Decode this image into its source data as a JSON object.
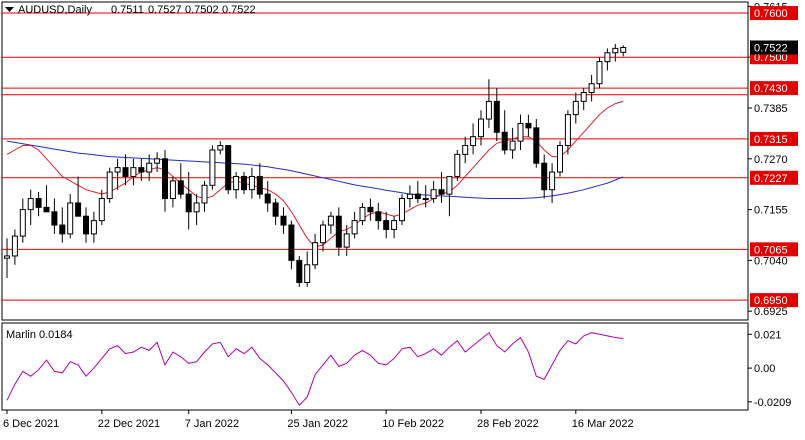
{
  "header": {
    "symbol": "AUDUSD,Daily",
    "open": "0.7511",
    "high": "0.7527",
    "low": "0.7502",
    "close": "0.7522"
  },
  "colors": {
    "background": "#ffffff",
    "frame": "#000000",
    "level_line": "#e00000",
    "level_label_bg": "#e00000",
    "level_label_text": "#ffffff",
    "ma_fast": "#e0202a",
    "ma_slow": "#2030c0",
    "indicator": "#b000b0",
    "current_label_bg": "#000000",
    "current_label_text": "#ffffff"
  },
  "chart_data": [
    {
      "type": "candlestick",
      "y_ticks": [
        "0.7615",
        "0.7500",
        "0.7385",
        "0.7270",
        "0.7155",
        "0.7040",
        "0.6925"
      ],
      "ylim": [
        0.6905,
        0.7625
      ],
      "x_ticks": [
        {
          "label": "6 Dec 2021",
          "index": 0
        },
        {
          "label": "22 Dec 2021",
          "index": 12
        },
        {
          "label": "7 Jan 2022",
          "index": 23
        },
        {
          "label": "25 Jan 2022",
          "index": 36
        },
        {
          "label": "10 Feb 2022",
          "index": 48
        },
        {
          "label": "28 Feb 2022",
          "index": 60
        },
        {
          "label": "16 Mar 2022",
          "index": 72
        }
      ],
      "levels": [
        "0.7600",
        "0.7500",
        "0.7430",
        "0.7415",
        "0.7315",
        "0.7227",
        "0.7065",
        "0.6950"
      ],
      "level_labels": [
        "0.7600",
        "0.7500",
        "0.7430",
        "0.7315",
        "0.7227",
        "0.7065",
        "0.6950"
      ],
      "current_price": "0.7522",
      "ohlc": [
        [
          0.7045,
          0.709,
          0.7,
          0.705
        ],
        [
          0.705,
          0.711,
          0.703,
          0.7095
        ],
        [
          0.7095,
          0.718,
          0.708,
          0.7155
        ],
        [
          0.7155,
          0.72,
          0.712,
          0.718
        ],
        [
          0.718,
          0.7195,
          0.714,
          0.716
        ],
        [
          0.716,
          0.721,
          0.715,
          0.715
        ],
        [
          0.715,
          0.718,
          0.71,
          0.712
        ],
        [
          0.712,
          0.716,
          0.708,
          0.71
        ],
        [
          0.71,
          0.719,
          0.709,
          0.717
        ],
        [
          0.717,
          0.723,
          0.714,
          0.714
        ],
        [
          0.714,
          0.716,
          0.708,
          0.71
        ],
        [
          0.71,
          0.715,
          0.708,
          0.713
        ],
        [
          0.713,
          0.72,
          0.712,
          0.718
        ],
        [
          0.718,
          0.725,
          0.717,
          0.724
        ],
        [
          0.724,
          0.727,
          0.72,
          0.725
        ],
        [
          0.725,
          0.728,
          0.721,
          0.723
        ],
        [
          0.723,
          0.727,
          0.721,
          0.725
        ],
        [
          0.725,
          0.727,
          0.722,
          0.724
        ],
        [
          0.724,
          0.728,
          0.722,
          0.726
        ],
        [
          0.726,
          0.7285,
          0.724,
          0.727
        ],
        [
          0.727,
          0.729,
          0.715,
          0.718
        ],
        [
          0.718,
          0.723,
          0.716,
          0.722
        ],
        [
          0.722,
          0.726,
          0.718,
          0.719
        ],
        [
          0.719,
          0.724,
          0.711,
          0.715
        ],
        [
          0.715,
          0.719,
          0.712,
          0.717
        ],
        [
          0.717,
          0.722,
          0.715,
          0.721
        ],
        [
          0.721,
          0.73,
          0.72,
          0.729
        ],
        [
          0.729,
          0.731,
          0.728,
          0.73
        ],
        [
          0.73,
          0.73,
          0.719,
          0.72
        ],
        [
          0.72,
          0.724,
          0.718,
          0.723
        ],
        [
          0.723,
          0.724,
          0.719,
          0.72
        ],
        [
          0.72,
          0.725,
          0.718,
          0.723
        ],
        [
          0.723,
          0.726,
          0.718,
          0.719
        ],
        [
          0.719,
          0.722,
          0.715,
          0.717
        ],
        [
          0.717,
          0.718,
          0.712,
          0.714
        ],
        [
          0.714,
          0.716,
          0.71,
          0.712
        ],
        [
          0.712,
          0.713,
          0.702,
          0.704
        ],
        [
          0.704,
          0.705,
          0.698,
          0.699
        ],
        [
          0.699,
          0.706,
          0.698,
          0.703
        ],
        [
          0.703,
          0.71,
          0.702,
          0.708
        ],
        [
          0.708,
          0.713,
          0.706,
          0.712
        ],
        [
          0.712,
          0.715,
          0.71,
          0.714
        ],
        [
          0.714,
          0.716,
          0.705,
          0.707
        ],
        [
          0.707,
          0.712,
          0.705,
          0.71
        ],
        [
          0.71,
          0.715,
          0.709,
          0.713
        ],
        [
          0.713,
          0.717,
          0.712,
          0.716
        ],
        [
          0.716,
          0.718,
          0.713,
          0.715
        ],
        [
          0.715,
          0.717,
          0.711,
          0.713
        ],
        [
          0.713,
          0.715,
          0.709,
          0.711
        ],
        [
          0.711,
          0.714,
          0.709,
          0.713
        ],
        [
          0.713,
          0.719,
          0.712,
          0.718
        ],
        [
          0.718,
          0.721,
          0.716,
          0.719
        ],
        [
          0.719,
          0.722,
          0.717,
          0.718
        ],
        [
          0.718,
          0.721,
          0.716,
          0.718
        ],
        [
          0.718,
          0.722,
          0.717,
          0.72
        ],
        [
          0.72,
          0.724,
          0.717,
          0.719
        ],
        [
          0.719,
          0.723,
          0.714,
          0.723
        ],
        [
          0.723,
          0.729,
          0.722,
          0.728
        ],
        [
          0.728,
          0.732,
          0.726,
          0.73
        ],
        [
          0.73,
          0.735,
          0.728,
          0.732
        ],
        [
          0.732,
          0.738,
          0.73,
          0.736
        ],
        [
          0.736,
          0.745,
          0.734,
          0.74
        ],
        [
          0.74,
          0.743,
          0.731,
          0.733
        ],
        [
          0.733,
          0.738,
          0.728,
          0.729
        ],
        [
          0.729,
          0.734,
          0.727,
          0.731
        ],
        [
          0.731,
          0.737,
          0.729,
          0.735
        ],
        [
          0.735,
          0.737,
          0.732,
          0.734
        ],
        [
          0.734,
          0.736,
          0.725,
          0.726
        ],
        [
          0.726,
          0.728,
          0.718,
          0.72
        ],
        [
          0.72,
          0.726,
          0.717,
          0.724
        ],
        [
          0.724,
          0.731,
          0.723,
          0.73
        ],
        [
          0.73,
          0.738,
          0.728,
          0.737
        ],
        [
          0.737,
          0.742,
          0.735,
          0.74
        ],
        [
          0.74,
          0.743,
          0.738,
          0.742
        ],
        [
          0.742,
          0.746,
          0.74,
          0.744
        ],
        [
          0.744,
          0.75,
          0.743,
          0.749
        ],
        [
          0.749,
          0.752,
          0.747,
          0.751
        ],
        [
          0.751,
          0.753,
          0.749,
          0.752
        ],
        [
          0.7511,
          0.7527,
          0.7502,
          0.7522
        ]
      ],
      "ma_fast": [
        0.728,
        0.729,
        0.73,
        0.73,
        0.729,
        0.727,
        0.725,
        0.723,
        0.722,
        0.721,
        0.72,
        0.7195,
        0.719,
        0.7195,
        0.7205,
        0.7215,
        0.723,
        0.724,
        0.7245,
        0.725,
        0.7245,
        0.723,
        0.7215,
        0.72,
        0.7185,
        0.718,
        0.7185,
        0.72,
        0.7215,
        0.722,
        0.7215,
        0.721,
        0.7205,
        0.72,
        0.719,
        0.7175,
        0.715,
        0.712,
        0.709,
        0.707,
        0.7075,
        0.709,
        0.7105,
        0.711,
        0.712,
        0.7135,
        0.7145,
        0.715,
        0.7145,
        0.714,
        0.7145,
        0.7155,
        0.7165,
        0.717,
        0.718,
        0.719,
        0.7195,
        0.721,
        0.723,
        0.725,
        0.727,
        0.729,
        0.7305,
        0.731,
        0.7315,
        0.732,
        0.732,
        0.731,
        0.729,
        0.7275,
        0.7275,
        0.729,
        0.731,
        0.733,
        0.735,
        0.737,
        0.7385,
        0.7395,
        0.74
      ],
      "ma_slow": [
        0.731,
        0.7307,
        0.7304,
        0.7301,
        0.7298,
        0.7295,
        0.7292,
        0.7289,
        0.7286,
        0.7283,
        0.7281,
        0.7279,
        0.7277,
        0.7275,
        0.7274,
        0.7273,
        0.7272,
        0.7271,
        0.727,
        0.7269,
        0.7268,
        0.7267,
        0.7266,
        0.7265,
        0.7264,
        0.7263,
        0.7262,
        0.7261,
        0.726,
        0.7259,
        0.7258,
        0.7256,
        0.7254,
        0.7252,
        0.7249,
        0.7246,
        0.7243,
        0.7239,
        0.7235,
        0.7231,
        0.7227,
        0.7223,
        0.7219,
        0.7215,
        0.7211,
        0.7208,
        0.7205,
        0.7202,
        0.7199,
        0.7196,
        0.7193,
        0.719,
        0.7189,
        0.7188,
        0.7187,
        0.7186,
        0.7185,
        0.7184,
        0.7183,
        0.7182,
        0.7181,
        0.718,
        0.718,
        0.718,
        0.718,
        0.718,
        0.7181,
        0.7182,
        0.7184,
        0.7186,
        0.7189,
        0.7192,
        0.7196,
        0.72,
        0.7205,
        0.721,
        0.7215,
        0.7222,
        0.7229
      ]
    },
    {
      "type": "line",
      "name": "Marlin",
      "label": "Marlin 0.0184",
      "y_ticks": [
        "0.021",
        "0.00",
        "-0.0209"
      ],
      "ylim": [
        -0.026,
        0.028
      ],
      "values": [
        -0.02,
        -0.01,
        -0.002,
        -0.005,
        -0.001,
        0.005,
        -0.002,
        -0.003,
        0.004,
        0.002,
        -0.005,
        0.0,
        0.006,
        0.012,
        0.014,
        0.009,
        0.01,
        0.013,
        0.011,
        0.016,
        0.002,
        0.01,
        0.007,
        0.003,
        0.004,
        0.01,
        0.015,
        0.016,
        0.007,
        0.012,
        0.009,
        0.013,
        0.006,
        0.002,
        -0.003,
        -0.008,
        -0.015,
        -0.023,
        -0.018,
        -0.004,
        0.002,
        0.008,
        0.001,
        0.003,
        0.008,
        0.011,
        0.008,
        0.003,
        0.002,
        0.006,
        0.012,
        0.013,
        0.007,
        0.009,
        0.012,
        0.008,
        0.013,
        0.017,
        0.01,
        0.014,
        0.018,
        0.022,
        0.014,
        0.01,
        0.015,
        0.019,
        0.01,
        -0.005,
        -0.007,
        0.002,
        0.011,
        0.017,
        0.015,
        0.02,
        0.022,
        0.021,
        0.02,
        0.019,
        0.0184
      ]
    }
  ]
}
